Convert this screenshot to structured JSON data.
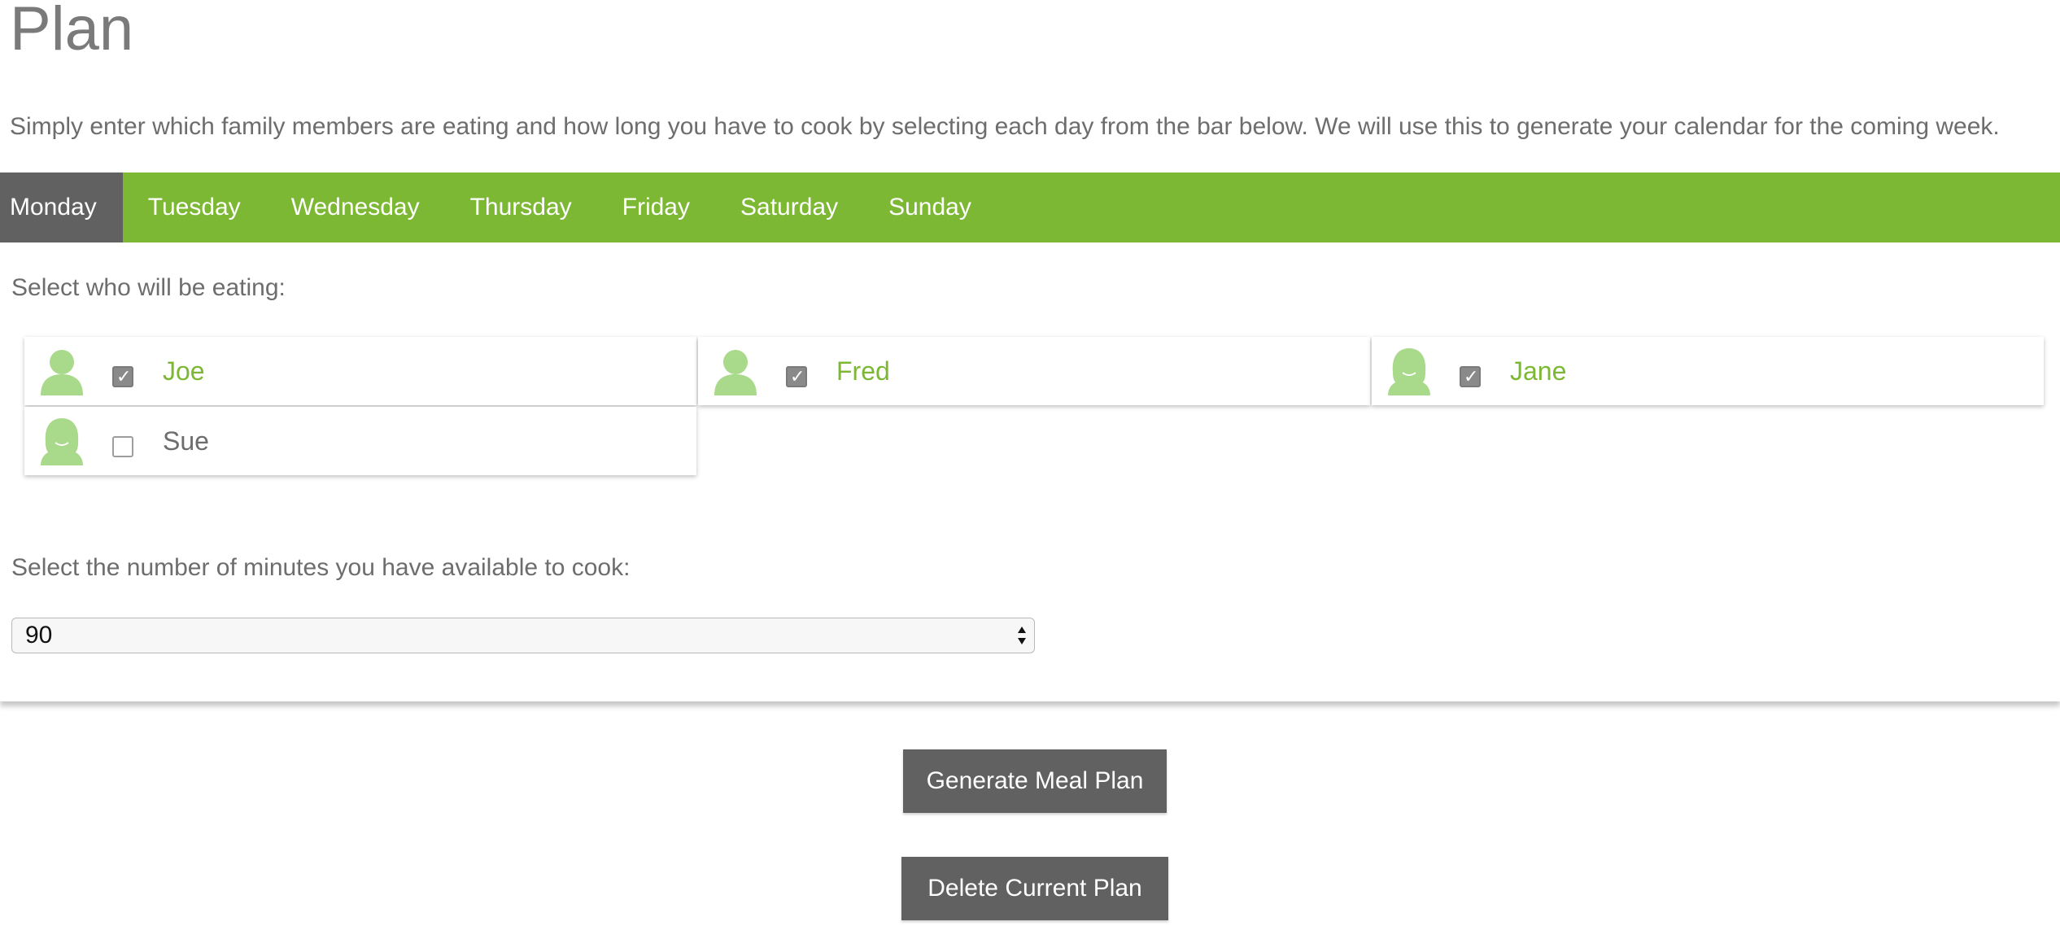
{
  "header": {
    "title": "Plan",
    "intro": "Simply enter which family members are eating and how long you have to cook by selecting each day from the bar below. We will use this to generate your calendar for the coming week."
  },
  "days": {
    "items": [
      {
        "label": "Monday",
        "active": true
      },
      {
        "label": "Tuesday",
        "active": false
      },
      {
        "label": "Wednesday",
        "active": false
      },
      {
        "label": "Thursday",
        "active": false
      },
      {
        "label": "Friday",
        "active": false
      },
      {
        "label": "Saturday",
        "active": false
      },
      {
        "label": "Sunday",
        "active": false
      }
    ]
  },
  "eating": {
    "label": "Select who will be eating:",
    "members": [
      {
        "name": "Joe",
        "checked": true,
        "avatar": "male-avatar-icon"
      },
      {
        "name": "Fred",
        "checked": true,
        "avatar": "male-avatar-icon"
      },
      {
        "name": "Jane",
        "checked": true,
        "avatar": "female-avatar-icon"
      },
      {
        "name": "Sue",
        "checked": false,
        "avatar": "female-avatar-icon"
      }
    ]
  },
  "minutes": {
    "label": "Select the number of minutes you have available to cook:",
    "selected": "90"
  },
  "actions": {
    "generate_label": "Generate Meal Plan",
    "delete_label": "Delete Current Plan"
  },
  "colors": {
    "accent": "#7cb834",
    "active_tab": "#616161",
    "button": "#616161",
    "avatar": "#a9d98a"
  }
}
